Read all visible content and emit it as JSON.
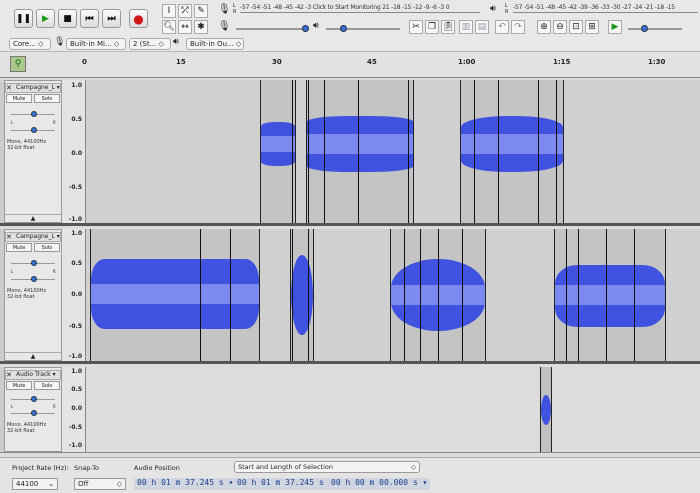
{
  "transport": {
    "pause": "pause-icon",
    "play": "play-icon",
    "stop": "stop-icon",
    "skip_start": "skip-start-icon",
    "skip_end": "skip-end-icon",
    "record": "record-icon"
  },
  "meters": {
    "record_scale": "-57 -54 -51 -48 -45 -42 -3 Click to Start Monitoring 21 -18 -15 -12 -9 -6 -3 0",
    "playback_scale": "-57 -54 -51 -48 -45 -42 -39 -36 -33 -30 -27 -24 -21 -18 -15"
  },
  "devices": {
    "host": "Core...",
    "mic": "Built-in Mi...",
    "channels": "2 (St...",
    "output": "Built-in Ou..."
  },
  "ruler": {
    "ticks": [
      "0",
      "15",
      "30",
      "45",
      "1:00",
      "1:15",
      "1:30"
    ]
  },
  "tracks": [
    {
      "name": "Campagne_L",
      "mute": "Mute",
      "solo": "Solo",
      "format1": "Mono, 44100Hz",
      "format2": "32-bit float",
      "scale": [
        "1.0",
        "0.5",
        "0.0",
        "-0.5",
        "-1.0"
      ]
    },
    {
      "name": "Campagne_L",
      "mute": "Mute",
      "solo": "Solo",
      "format1": "Mono, 44100Hz",
      "format2": "32-bit float",
      "scale": [
        "1.0",
        "0.5",
        "0.0",
        "-0.5",
        "-1.0"
      ]
    },
    {
      "name": "Audio Track",
      "mute": "Mute",
      "solo": "Solo",
      "format1": "Mono, 44100Hz",
      "format2": "32-bit float",
      "scale": [
        "1.0",
        "0.5",
        "0.0",
        "-0.5",
        "-1.0"
      ]
    }
  ],
  "bottom": {
    "rate_label": "Project Rate (Hz):",
    "rate_value": "44100",
    "snap_label": "Snap-To",
    "snap_value": "Off",
    "pos_label": "Audio Position",
    "pos_value": "00 h 01 m 37.245 s",
    "sel_label": "Start and Length of Selection",
    "sel_start": "00 h 01 m 37.245 s",
    "sel_len": "00 h 00 m 00.000 s"
  }
}
